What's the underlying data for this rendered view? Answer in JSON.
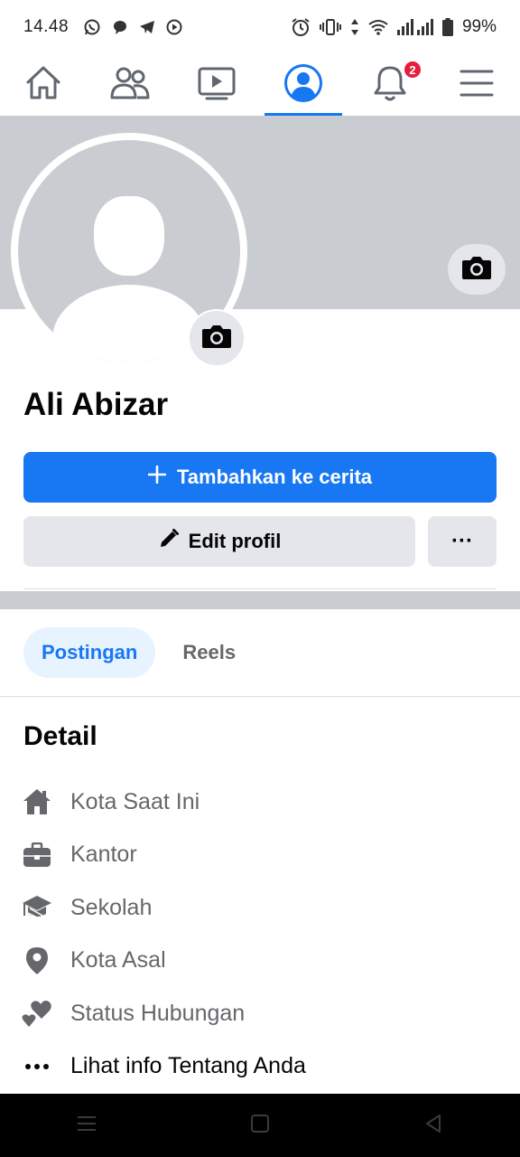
{
  "status_bar": {
    "time": "14.48",
    "battery": "99%",
    "left_icons": [
      "whatsapp-icon",
      "chat-icon",
      "telegram-icon",
      "play-icon"
    ],
    "right_icons": [
      "alarm-icon",
      "vibrate-icon",
      "data-icon",
      "wifi-icon",
      "signal-icon",
      "battery-icon"
    ]
  },
  "nav": {
    "tabs": [
      {
        "icon": "home-icon"
      },
      {
        "icon": "friends-icon"
      },
      {
        "icon": "video-icon"
      },
      {
        "icon": "profile-icon"
      },
      {
        "icon": "bell-icon"
      },
      {
        "icon": "menu-icon"
      }
    ],
    "active_index": 3,
    "notification_count": "2"
  },
  "profile": {
    "name": "Ali Abizar"
  },
  "actions": {
    "add_story": "Tambahkan ke cerita",
    "edit_profile": "Edit profil",
    "more": "···"
  },
  "content_tabs": [
    {
      "label": "Postingan"
    },
    {
      "label": "Reels"
    }
  ],
  "details": {
    "title": "Detail",
    "items": [
      {
        "icon": "home-icon",
        "label": "Kota Saat Ini"
      },
      {
        "icon": "briefcase-icon",
        "label": "Kantor"
      },
      {
        "icon": "graduation-cap-icon",
        "label": "Sekolah"
      },
      {
        "icon": "location-pin-icon",
        "label": "Kota Asal"
      },
      {
        "icon": "hearts-icon",
        "label": "Status Hubungan"
      },
      {
        "icon": "more-dots-icon",
        "label": "Lihat info Tentang Anda"
      }
    ]
  },
  "colors": {
    "accent": "#1877f2",
    "badge": "#e41e3f",
    "cover": "#c9ccd1",
    "button_secondary": "#e4e6eb",
    "muted_text": "#65676b"
  }
}
